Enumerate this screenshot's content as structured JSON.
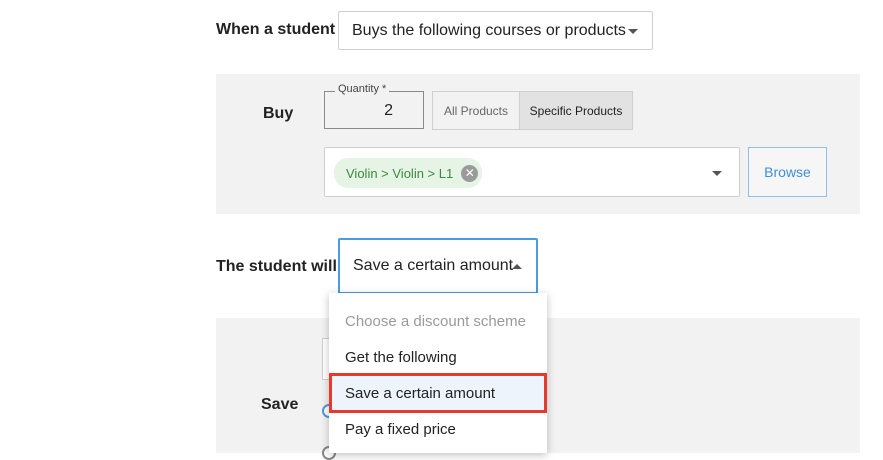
{
  "trigger": {
    "label": "When a student",
    "selected": "Buys the following courses or products"
  },
  "buy": {
    "label": "Buy",
    "quantity_label": "Quantity *",
    "quantity_value": "2",
    "segments": [
      "All Products",
      "Specific Products"
    ],
    "active_segment": "Specific Products",
    "tags": [
      "Violin > Violin > L1"
    ],
    "browse_label": "Browse"
  },
  "action": {
    "label": "The student will",
    "selected": "Save a certain amount"
  },
  "dropdown": {
    "items": [
      {
        "label": "Choose a discount scheme",
        "placeholder": true
      },
      {
        "label": "Get the following"
      },
      {
        "label": "Save a certain amount",
        "selected": true
      },
      {
        "label": "Pay a fixed price"
      }
    ]
  },
  "save": {
    "label": "Save"
  },
  "colors": {
    "accent": "#3d8fd6",
    "tag_bg": "#e6f4e6",
    "tag_text": "#3b8a3b",
    "highlight": "#e63a2e",
    "panel_bg": "#f2f2f2"
  }
}
